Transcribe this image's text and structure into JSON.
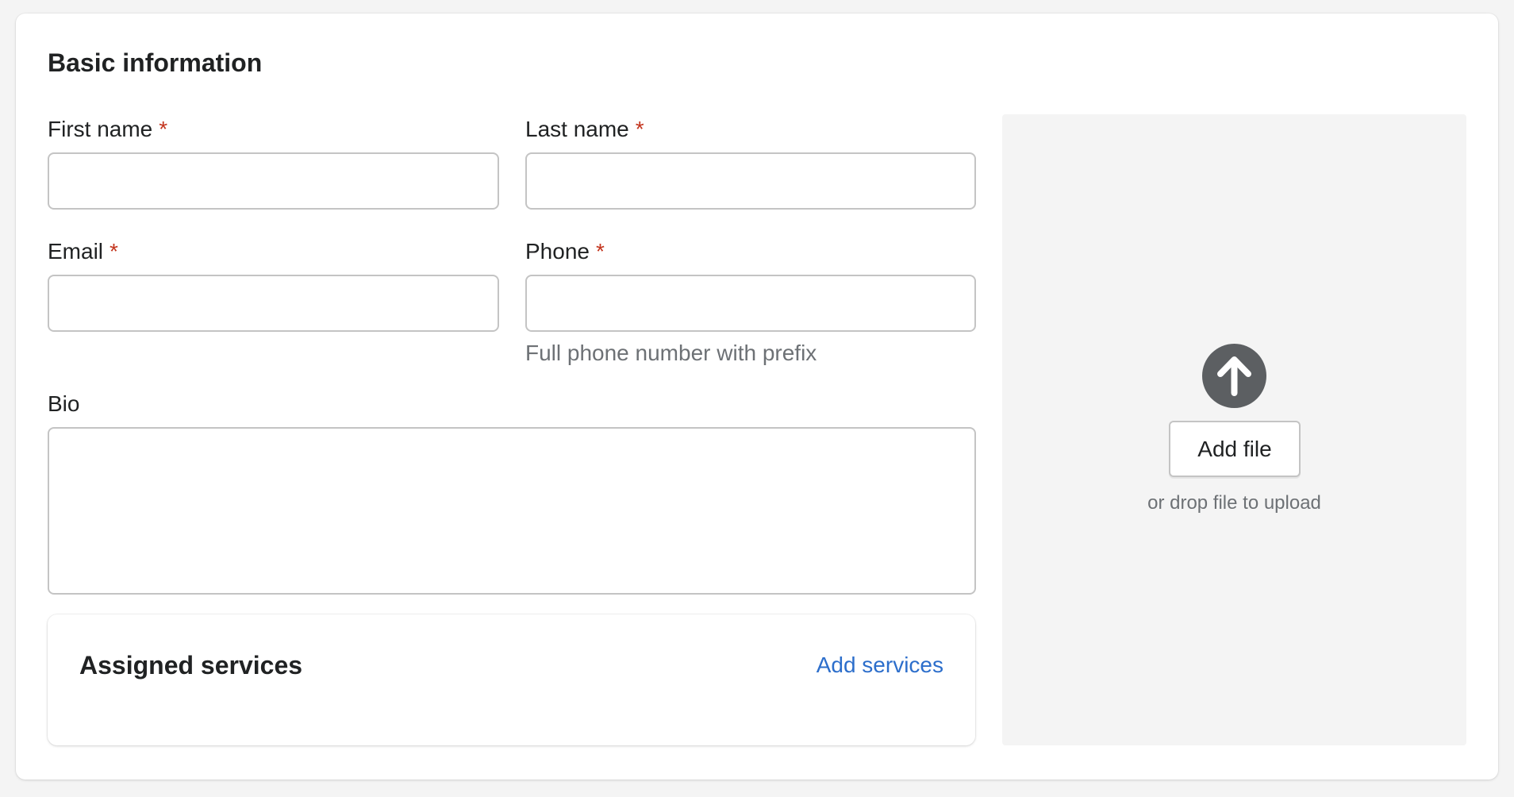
{
  "section": {
    "title": "Basic information"
  },
  "fields": {
    "first_name": {
      "label": "First name",
      "required_mark": "*",
      "value": ""
    },
    "last_name": {
      "label": "Last name",
      "required_mark": "*",
      "value": ""
    },
    "email": {
      "label": "Email",
      "required_mark": "*",
      "value": ""
    },
    "phone": {
      "label": "Phone",
      "required_mark": "*",
      "value": "",
      "help": "Full phone number with prefix"
    },
    "bio": {
      "label": "Bio",
      "value": ""
    }
  },
  "services": {
    "title": "Assigned services",
    "action_label": "Add services"
  },
  "upload": {
    "icon": "arrow-up-circle-icon",
    "button_label": "Add file",
    "hint": "or drop file to upload"
  },
  "colors": {
    "required": "#c3341d",
    "link": "#2c6ecb",
    "icon_bg": "#5c5f62",
    "dropzone_bg": "#f4f4f4"
  }
}
